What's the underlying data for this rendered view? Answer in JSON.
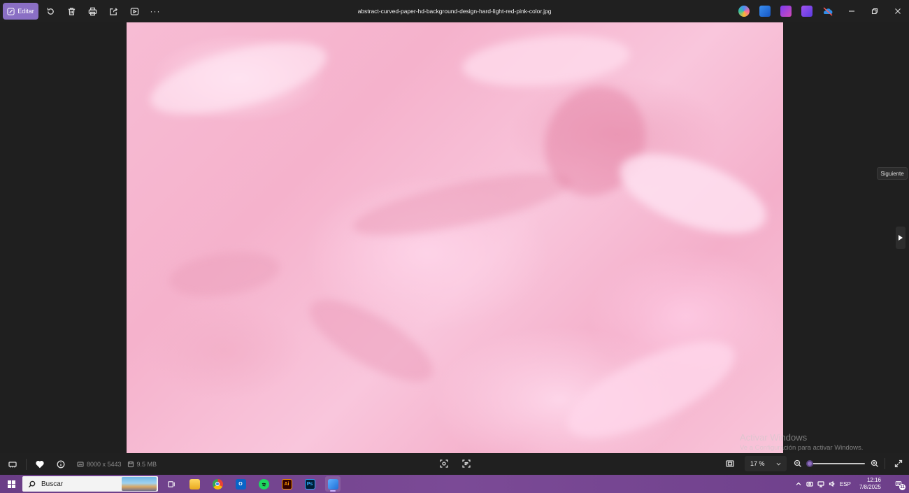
{
  "window": {
    "title": "abstract-curved-paper-hd-background-design-hard-light-red-pink-color.jpg"
  },
  "toolbar": {
    "edit_label": "Editar",
    "tools": [
      "rotate-icon",
      "delete-icon",
      "print-icon",
      "share-icon",
      "slideshow-icon",
      "more-icon"
    ],
    "more_label": "···"
  },
  "nav": {
    "next_tooltip": "Siguiente"
  },
  "image_info": {
    "dimensions": "8000 x 5443",
    "file_size": "9.5 MB"
  },
  "zoom": {
    "level": "17 %",
    "slider_fraction": 0.0
  },
  "watermark": {
    "line1": "Activar Windows",
    "line2": "Ve a Configuración para activar Windows."
  },
  "taskbar": {
    "search_placeholder": "Buscar",
    "language": "ESP",
    "time": "12:16",
    "date": "7/8/2025",
    "notification_count": "11",
    "apps": [
      {
        "name": "task-view",
        "color": "#ffffff"
      },
      {
        "name": "file-explorer",
        "color": "#f4c542"
      },
      {
        "name": "chrome",
        "color": "#34a853"
      },
      {
        "name": "outlook",
        "color": "#0a64c7",
        "text": "O"
      },
      {
        "name": "spotify",
        "color": "#1ed760"
      },
      {
        "name": "illustrator",
        "color": "#330000",
        "text": "Ai"
      },
      {
        "name": "photoshop",
        "color": "#001e36",
        "text": "Ps"
      },
      {
        "name": "photos",
        "color": "#3b8de0"
      }
    ]
  },
  "colors": {
    "accent": "#8a6fc4",
    "taskbar": "#6a3d86",
    "image_pink": "#f7bcd4"
  }
}
